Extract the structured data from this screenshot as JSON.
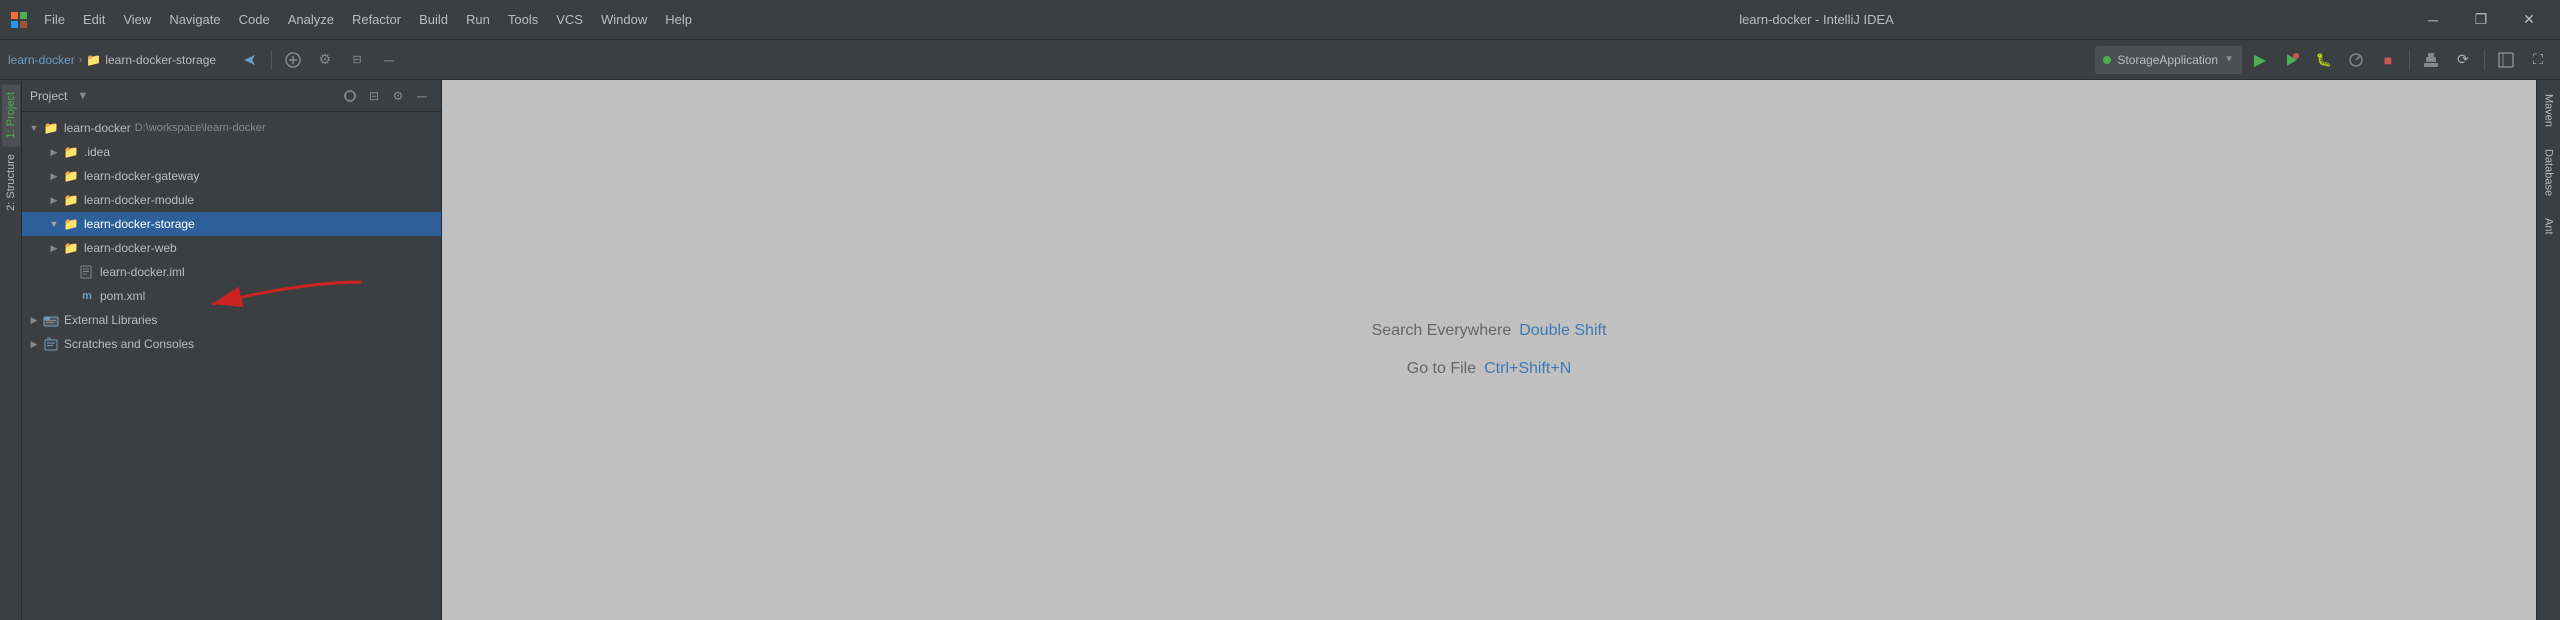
{
  "titlebar": {
    "app_title": "learn-docker - IntelliJ IDEA",
    "menu_items": [
      "File",
      "Edit",
      "View",
      "Navigate",
      "Code",
      "Analyze",
      "Refactor",
      "Build",
      "Run",
      "Tools",
      "VCS",
      "Window",
      "Help"
    ]
  },
  "breadcrumb": {
    "root": "learn-docker",
    "current": "learn-docker-storage"
  },
  "run_config": {
    "name": "StorageApplication",
    "dot_color": "#4caf50"
  },
  "project_panel": {
    "title": "Project",
    "root_item": {
      "name": "learn-docker",
      "path": "D:\\workspace\\learn-docker"
    },
    "items": [
      {
        "id": "idea",
        "label": ".idea",
        "indent": 2,
        "type": "folder",
        "expanded": false
      },
      {
        "id": "gateway",
        "label": "learn-docker-gateway",
        "indent": 2,
        "type": "folder",
        "expanded": false
      },
      {
        "id": "module",
        "label": "learn-docker-module",
        "indent": 2,
        "type": "folder",
        "expanded": false
      },
      {
        "id": "storage",
        "label": "learn-docker-storage",
        "indent": 2,
        "type": "folder",
        "expanded": true,
        "selected": true
      },
      {
        "id": "web",
        "label": "learn-docker-web",
        "indent": 2,
        "type": "folder",
        "expanded": false
      },
      {
        "id": "iml",
        "label": "learn-docker.iml",
        "indent": 2,
        "type": "iml",
        "expanded": false
      },
      {
        "id": "pom",
        "label": "pom.xml",
        "indent": 2,
        "type": "xml",
        "expanded": false
      }
    ],
    "external_libs": "External Libraries",
    "scratches": "Scratches and Consoles"
  },
  "editor": {
    "search_label": "Search Everywhere",
    "search_key": "Double Shift",
    "goto_label": "Go to File",
    "goto_key": "Ctrl+Shift+N"
  },
  "right_tabs": [
    "Maven",
    "Database",
    "Ant"
  ],
  "left_tabs": [
    "1: Project",
    "2: Structure"
  ],
  "icons": {
    "expand": "▶",
    "collapse": "▼",
    "folder": "📁",
    "minimize": "─",
    "restore": "❐",
    "close": "✕",
    "settings": "⚙",
    "run": "▶",
    "stop": "■"
  }
}
